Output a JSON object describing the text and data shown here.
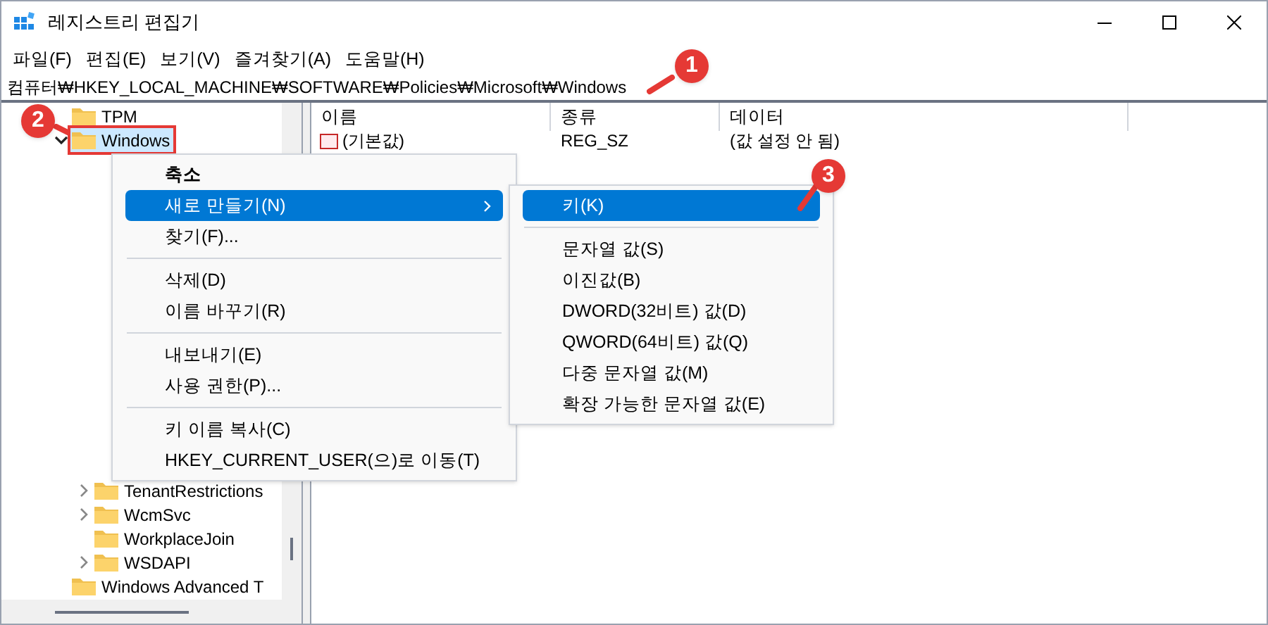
{
  "window": {
    "title": "레지스트리 편집기"
  },
  "menu_bar": [
    "파일(F)",
    "편집(E)",
    "보기(V)",
    "즐겨찾기(A)",
    "도움말(H)"
  ],
  "address_bar": {
    "value": "컴퓨터₩HKEY_LOCAL_MACHINE₩SOFTWARE₩Policies₩Microsoft₩Windows"
  },
  "tree": [
    {
      "label": "TPM",
      "expandable": false,
      "selected": false,
      "outlined": false
    },
    {
      "label": "Windows",
      "expandable": true,
      "expanded": true,
      "selected": true,
      "outlined": true,
      "children": [
        {
          "label": "TenantRestrictions",
          "expandable": true,
          "expanded": false,
          "selected": false,
          "outlined": false
        },
        {
          "label": "WcmSvc",
          "expandable": true,
          "expanded": false,
          "selected": false,
          "outlined": false
        },
        {
          "label": "WorkplaceJoin",
          "expandable": false,
          "selected": false,
          "outlined": false
        },
        {
          "label": "WSDAPI",
          "expandable": true,
          "expanded": false,
          "selected": false,
          "outlined": false
        }
      ]
    },
    {
      "label": "Windows Advanced T",
      "expandable": false,
      "selected": false,
      "outlined": false
    }
  ],
  "table": {
    "columns": [
      "이름",
      "종류",
      "데이터"
    ],
    "rows": [
      {
        "name": "(기본값)",
        "type": "REG_SZ",
        "data": "(값 설정 안 됨)"
      }
    ]
  },
  "context_menu": [
    {
      "kind": "item",
      "label": "축소",
      "bold": true,
      "selected": false,
      "submenu": false
    },
    {
      "kind": "item",
      "label": "새로 만들기(N)",
      "bold": false,
      "selected": true,
      "submenu": true
    },
    {
      "kind": "item",
      "label": "찾기(F)...",
      "bold": false,
      "selected": false,
      "submenu": false
    },
    {
      "kind": "separator"
    },
    {
      "kind": "item",
      "label": "삭제(D)",
      "bold": false,
      "selected": false,
      "submenu": false
    },
    {
      "kind": "item",
      "label": "이름 바꾸기(R)",
      "bold": false,
      "selected": false,
      "submenu": false
    },
    {
      "kind": "separator"
    },
    {
      "kind": "item",
      "label": "내보내기(E)",
      "bold": false,
      "selected": false,
      "submenu": false
    },
    {
      "kind": "item",
      "label": "사용 권한(P)...",
      "bold": false,
      "selected": false,
      "submenu": false
    },
    {
      "kind": "separator"
    },
    {
      "kind": "item",
      "label": "키 이름 복사(C)",
      "bold": false,
      "selected": false,
      "submenu": false
    },
    {
      "kind": "item",
      "label": "HKEY_CURRENT_USER(으)로 이동(T)",
      "bold": false,
      "selected": false,
      "submenu": false
    }
  ],
  "submenu": [
    {
      "kind": "item",
      "label": "키(K)",
      "selected": true
    },
    {
      "kind": "separator"
    },
    {
      "kind": "item",
      "label": "문자열 값(S)",
      "selected": false
    },
    {
      "kind": "item",
      "label": "이진값(B)",
      "selected": false
    },
    {
      "kind": "item",
      "label": "DWORD(32비트) 값(D)",
      "selected": false
    },
    {
      "kind": "item",
      "label": "QWORD(64비트) 값(Q)",
      "selected": false
    },
    {
      "kind": "item",
      "label": "다중 문자열 값(M)",
      "selected": false
    },
    {
      "kind": "item",
      "label": "확장 가능한 문자열 값(E)",
      "selected": false
    }
  ],
  "annotations": [
    {
      "label": "1"
    },
    {
      "label": "2"
    },
    {
      "label": "3"
    }
  ]
}
